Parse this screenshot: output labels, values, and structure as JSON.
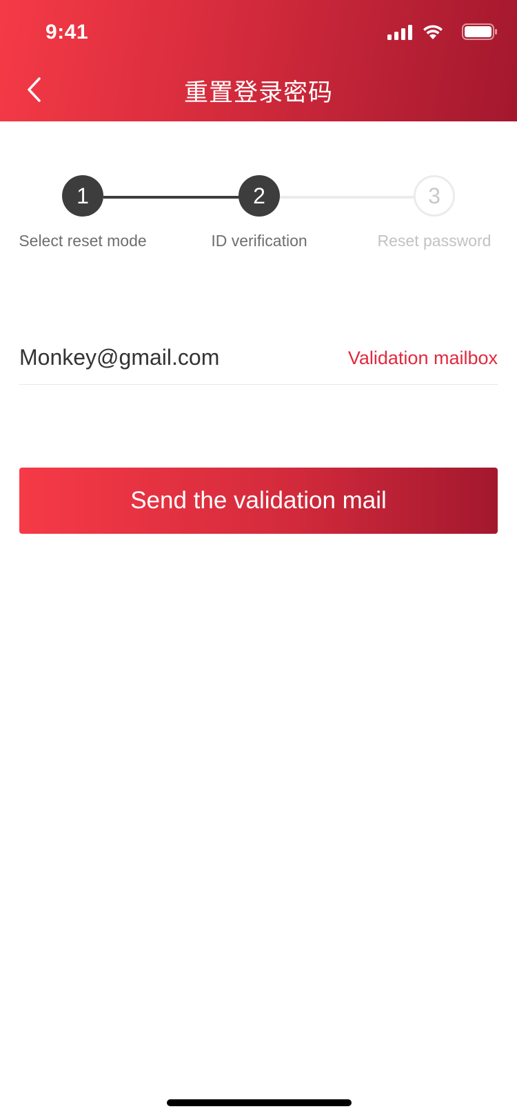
{
  "status_bar": {
    "time": "9:41",
    "icons": [
      "signal-icon",
      "wifi-icon",
      "battery-icon"
    ]
  },
  "nav": {
    "title": "重置登录密码",
    "back_icon": "chevron-left-icon"
  },
  "stepper": {
    "steps": [
      {
        "number": "1",
        "label": "Select reset mode",
        "state": "completed"
      },
      {
        "number": "2",
        "label": "ID verification",
        "state": "current"
      },
      {
        "number": "3",
        "label": "Reset password",
        "state": "pending"
      }
    ]
  },
  "email_field": {
    "value": "Monkey@gmail.com",
    "tag": "Validation mailbox"
  },
  "actions": {
    "send_label": "Send the validation mail"
  },
  "colors": {
    "brand_start": "#f53a47",
    "brand_end": "#a3182e",
    "accent_text": "#e1293e",
    "step_active": "#3d3d3d",
    "step_inactive": "#ebebeb"
  }
}
